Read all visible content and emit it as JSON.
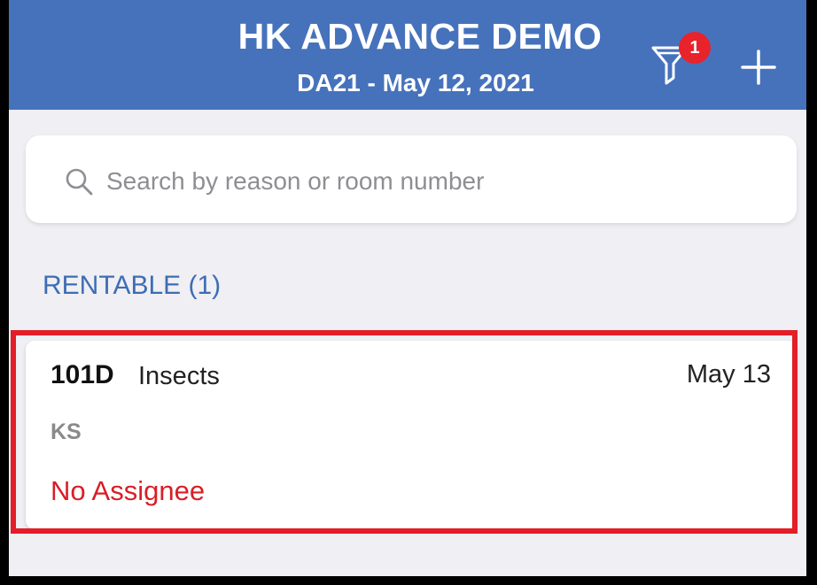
{
  "header": {
    "title": "HK ADVANCE DEMO",
    "subtitle": "DA21 - May 12, 2021",
    "filter_badge": "1",
    "filter_icon": "filter-icon",
    "add_icon": "plus-icon"
  },
  "search": {
    "placeholder": "Search by reason or room number",
    "value": "",
    "icon": "search-icon"
  },
  "section": {
    "label": "RENTABLE (1)"
  },
  "items": [
    {
      "room": "101D",
      "reason": "Insects",
      "date": "May 13",
      "initials": "KS",
      "assignee": "No Assignee"
    }
  ],
  "colors": {
    "header_bg": "#4672bc",
    "section_text": "#3e6db5",
    "badge": "#e8232b",
    "assignee_text": "#d81e28",
    "highlight_border": "#e31e28",
    "page_bg": "#efeff4"
  }
}
